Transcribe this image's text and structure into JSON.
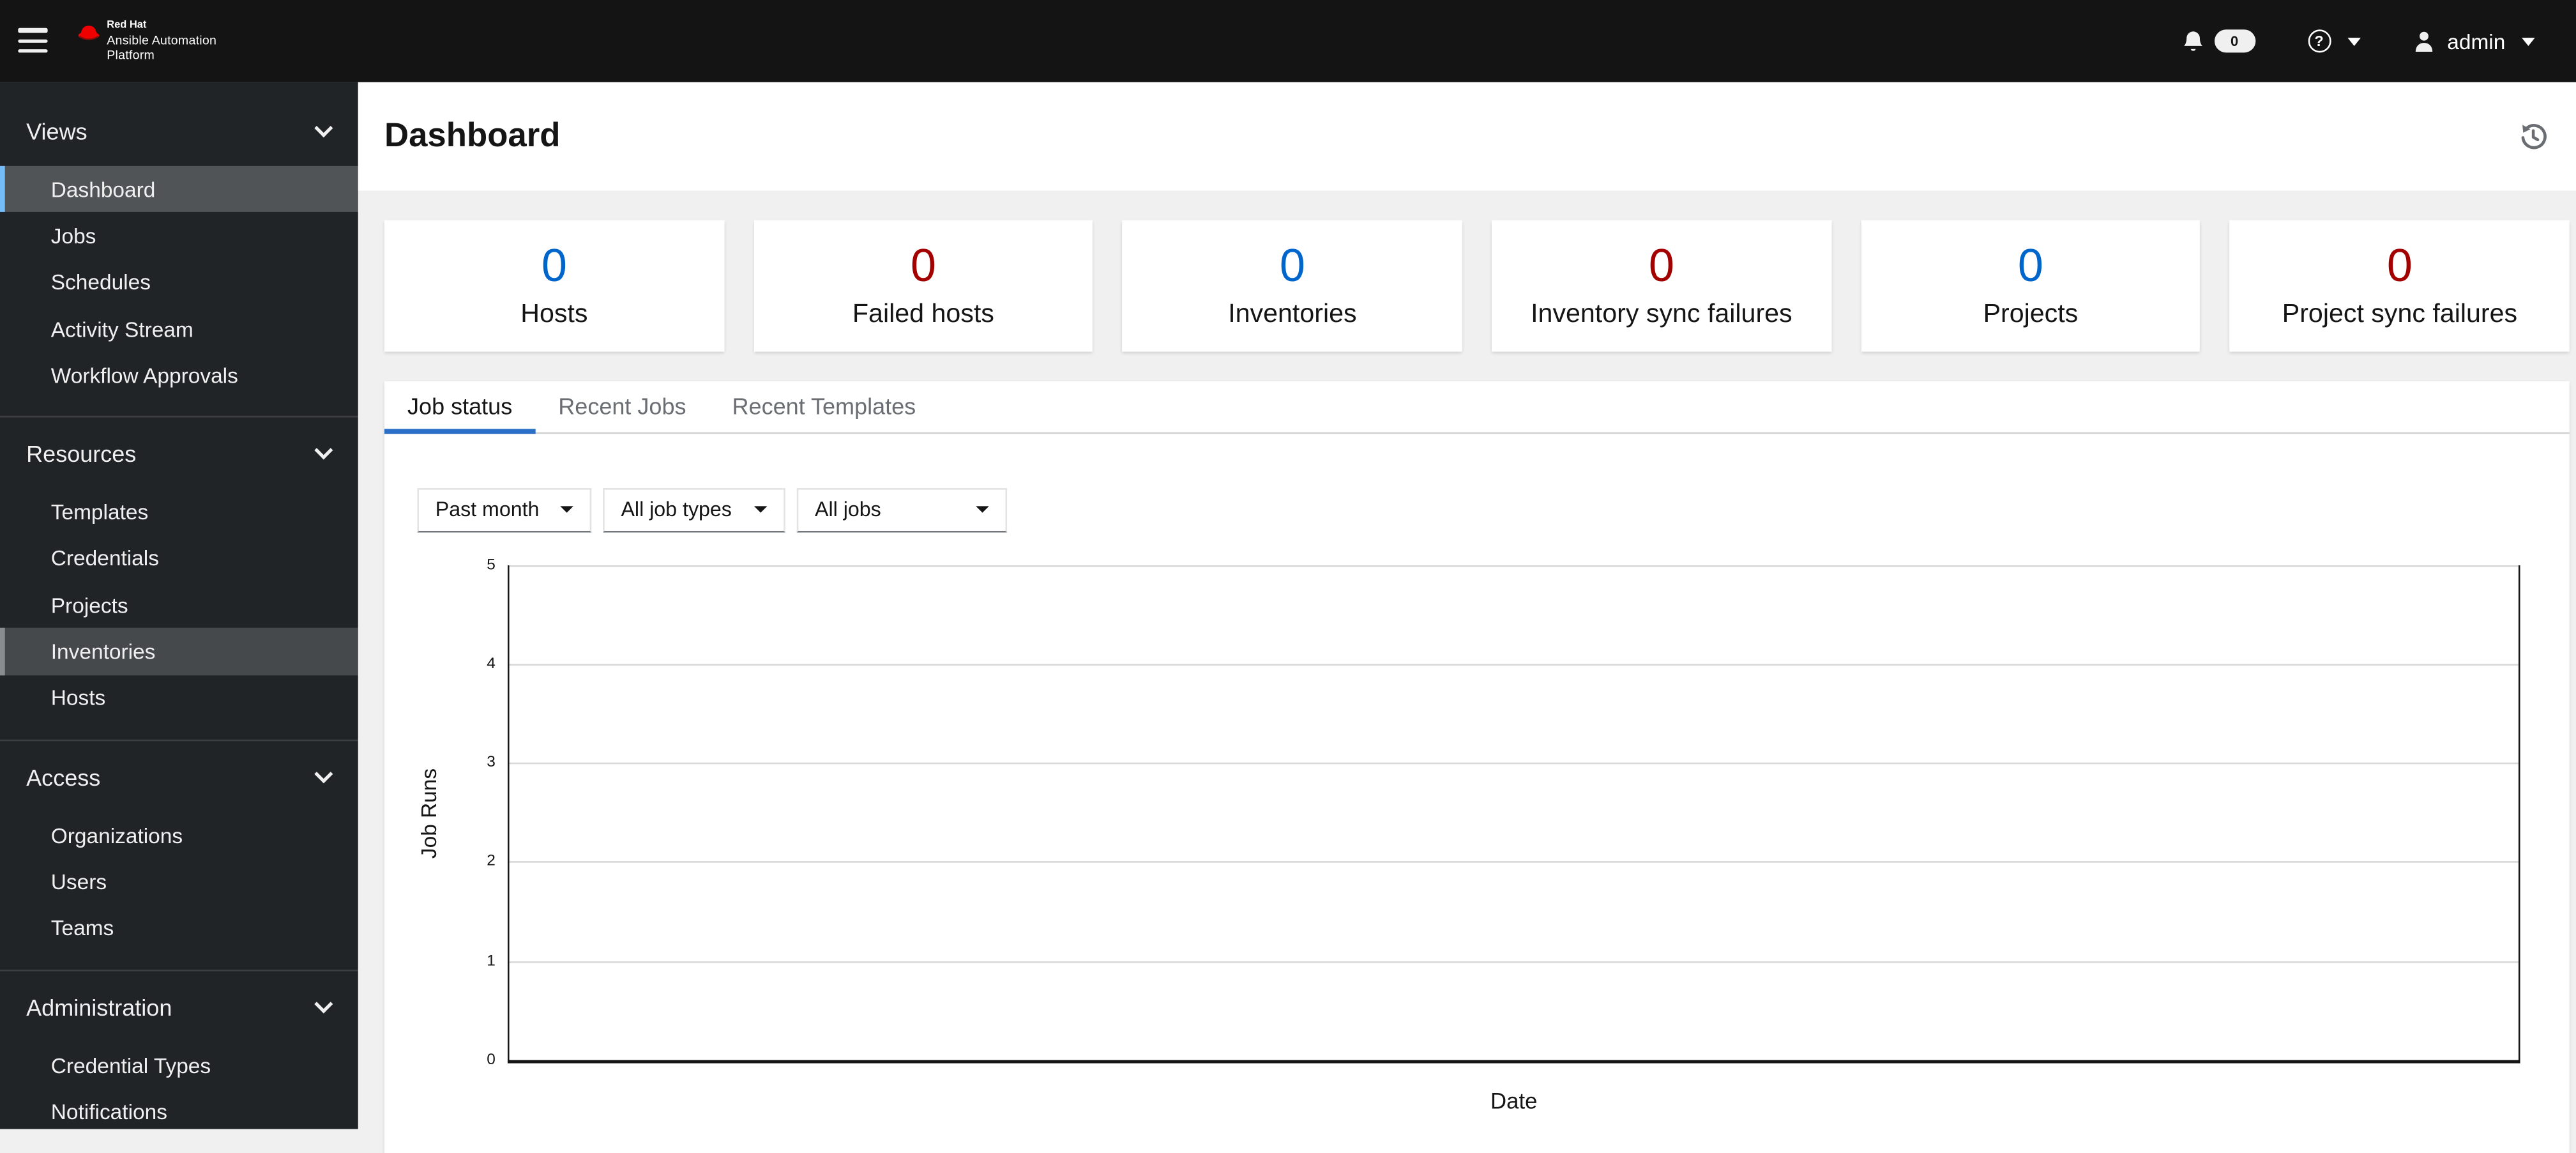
{
  "masthead": {
    "brand_line1": "Red Hat",
    "brand_line2": "Ansible Automation",
    "brand_line3": "Platform",
    "notification_count": "0",
    "username": "admin"
  },
  "sidebar": {
    "sections": [
      {
        "label": "Views",
        "items": [
          {
            "label": "Dashboard",
            "state": "active"
          },
          {
            "label": "Jobs",
            "state": "normal"
          },
          {
            "label": "Schedules",
            "state": "normal"
          },
          {
            "label": "Activity Stream",
            "state": "normal"
          },
          {
            "label": "Workflow Approvals",
            "state": "normal"
          }
        ]
      },
      {
        "label": "Resources",
        "items": [
          {
            "label": "Templates",
            "state": "normal"
          },
          {
            "label": "Credentials",
            "state": "normal"
          },
          {
            "label": "Projects",
            "state": "normal"
          },
          {
            "label": "Inventories",
            "state": "hover"
          },
          {
            "label": "Hosts",
            "state": "normal"
          }
        ]
      },
      {
        "label": "Access",
        "items": [
          {
            "label": "Organizations",
            "state": "normal"
          },
          {
            "label": "Users",
            "state": "normal"
          },
          {
            "label": "Teams",
            "state": "normal"
          }
        ]
      },
      {
        "label": "Administration",
        "items": [
          {
            "label": "Credential Types",
            "state": "normal"
          },
          {
            "label": "Notifications",
            "state": "normal"
          }
        ]
      }
    ]
  },
  "page": {
    "title": "Dashboard"
  },
  "cards": [
    {
      "value": "0",
      "label": "Hosts",
      "color": "#0066cc"
    },
    {
      "value": "0",
      "label": "Failed hosts",
      "color": "#a30000"
    },
    {
      "value": "0",
      "label": "Inventories",
      "color": "#0066cc"
    },
    {
      "value": "0",
      "label": "Inventory sync failures",
      "color": "#a30000"
    },
    {
      "value": "0",
      "label": "Projects",
      "color": "#0066cc"
    },
    {
      "value": "0",
      "label": "Project sync failures",
      "color": "#a30000"
    }
  ],
  "tabs": [
    {
      "label": "Job status",
      "active": true
    },
    {
      "label": "Recent Jobs",
      "active": false
    },
    {
      "label": "Recent Templates",
      "active": false
    }
  ],
  "filters": {
    "period": "Past month",
    "job_type": "All job types",
    "job": "All jobs"
  },
  "chart_data": {
    "type": "line",
    "title": "Job status",
    "xlabel": "Date",
    "ylabel": "Job Runs",
    "ylim": [
      0,
      5
    ],
    "yticks_desc": [
      "5",
      "4",
      "3",
      "2",
      "1",
      "0"
    ],
    "x": [],
    "series": [],
    "grid": "horizontal",
    "legend": "none"
  },
  "colors": {
    "accent_blue": "#0066cc",
    "danger_red": "#a30000",
    "nav_active_border": "#73bcf7",
    "tab_active_underline": "#2b6fc7",
    "masthead_bg": "#141414",
    "sidebar_bg": "#212427",
    "page_bg": "#f0f0f0"
  }
}
